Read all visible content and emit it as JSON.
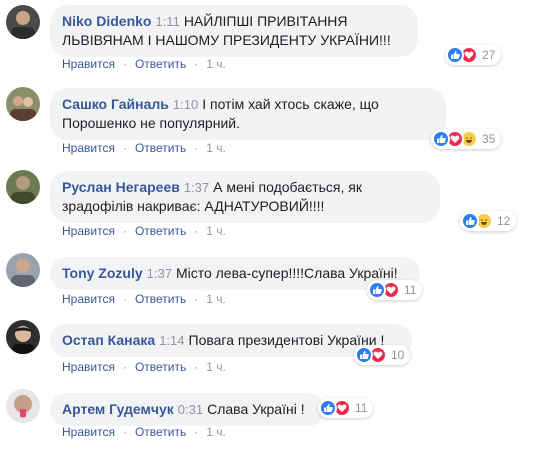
{
  "actions": {
    "like": "Нравится",
    "reply": "Ответить",
    "dot": "·"
  },
  "comments": [
    {
      "author": "Niko Didenko",
      "time": "1:11",
      "text": "НАЙЛІПШІ ПРИВІТАННЯ ЛЬВІВЯНАМ І НАШОМУ ПРЕЗИДЕНТУ УКРАЇНИ!!!",
      "reactions": [
        "like",
        "love"
      ],
      "count": "27",
      "age": "1 ч."
    },
    {
      "author": "Сашко Гайналь",
      "time": "1:10",
      "text": "І потім хай хтось скаже, що Порошенко не популярний.",
      "reactions": [
        "like",
        "love",
        "haha"
      ],
      "count": "35",
      "age": "1 ч."
    },
    {
      "author": "Руслан Негареев",
      "time": "1:37",
      "text": "А мені подобається, як зрадофілів накриває: АДНАТУРОВИЙ!!!!",
      "reactions": [
        "like",
        "haha"
      ],
      "count": "12",
      "age": "1 ч."
    },
    {
      "author": "Tony Zozuly",
      "time": "1:37",
      "text": "Місто лева-супер!!!!Слава Україні!",
      "reactions": [
        "like",
        "love"
      ],
      "count": "11",
      "age": "1 ч."
    },
    {
      "author": "Остап Канака",
      "time": "1:14",
      "text": "Повага президентові України !",
      "reactions": [
        "like",
        "love"
      ],
      "count": "10",
      "age": "1 ч."
    },
    {
      "author": "Артем Гудемчук",
      "time": "0:31",
      "text": "Слава Україні !",
      "reactions": [
        "like",
        "love"
      ],
      "count": "11",
      "age": "1 ч."
    }
  ]
}
